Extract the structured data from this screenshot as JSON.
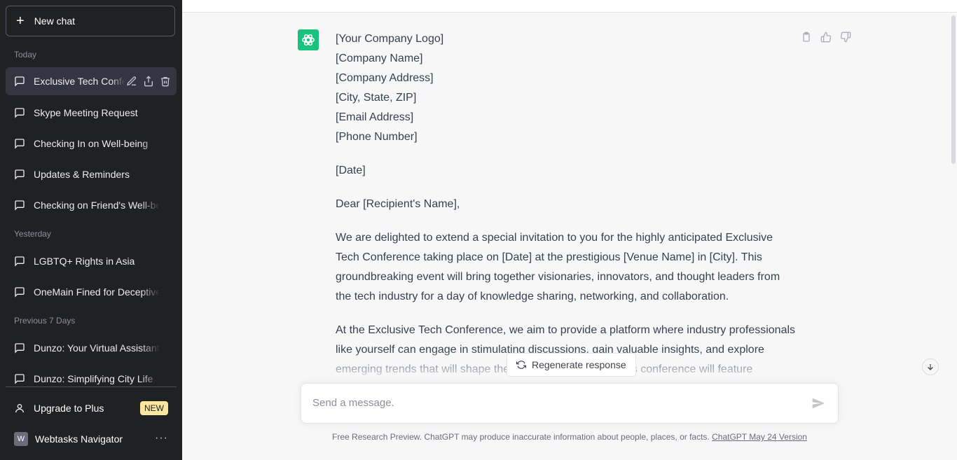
{
  "sidebar": {
    "new_chat": "New chat",
    "sections": {
      "today": "Today",
      "yesterday": "Yesterday",
      "previous": "Previous 7 Days"
    },
    "items": [
      {
        "label": "Exclusive Tech Conference",
        "active": true
      },
      {
        "label": "Skype Meeting Request"
      },
      {
        "label": "Checking In on Well-being"
      },
      {
        "label": "Updates & Reminders"
      },
      {
        "label": "Checking on Friend's Well-being"
      },
      {
        "label": "LGBTQ+ Rights in Asia"
      },
      {
        "label": "OneMain Fined for Deceptive"
      },
      {
        "label": "Dunzo: Your Virtual Assistant"
      },
      {
        "label": "Dunzo: Simplifying City Life"
      }
    ],
    "upgrade": "Upgrade to Plus",
    "new_badge": "NEW",
    "user_initial": "W",
    "user_name": "Webtasks Navigator",
    "more": "···"
  },
  "message": {
    "lines": [
      "[Your Company Logo]",
      "[Company Name]",
      "[Company Address]",
      "[City, State, ZIP]",
      "[Email Address]",
      "[Phone Number]"
    ],
    "date": "[Date]",
    "greeting": "Dear [Recipient's Name],",
    "para1": "We are delighted to extend a special invitation to you for the highly anticipated Exclusive Tech Conference taking place on [Date] at the prestigious [Venue Name] in [City]. This groundbreaking event will bring together visionaries, innovators, and thought leaders from the tech industry for a day of knowledge sharing, networking, and collaboration.",
    "para2": "At the Exclusive Tech Conference, we aim to provide a platform where industry professionals like yourself can engage in stimulating discussions, gain valuable insights, and explore emerging trends that will shape the future of technology. This conference will feature"
  },
  "regenerate": "Regenerate response",
  "input": {
    "placeholder": "Send a message."
  },
  "footer": {
    "text": "Free Research Preview. ChatGPT may produce inaccurate information about people, places, or facts. ",
    "link": "ChatGPT May 24 Version"
  },
  "colors": {
    "sidebar_bg": "#202123",
    "accent": "#19c37d",
    "main_bg": "#f7f7f8"
  }
}
